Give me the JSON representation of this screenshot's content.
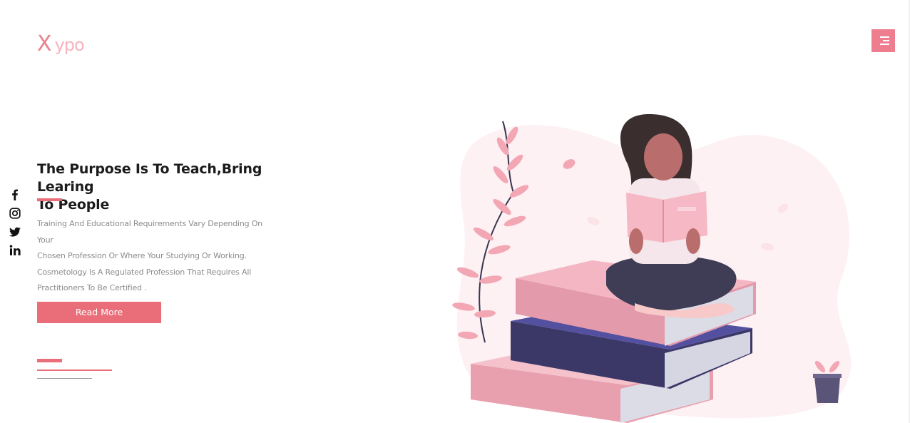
{
  "brand": {
    "logo_first": "X",
    "logo_rest": "ypo",
    "accent": "#e96e79",
    "accent_light": "#f6b3be"
  },
  "nav": {
    "menu_icon": "hamburger-icon"
  },
  "social": [
    {
      "name": "facebook-icon"
    },
    {
      "name": "instagram-icon"
    },
    {
      "name": "twitter-icon"
    },
    {
      "name": "linkedin-icon"
    }
  ],
  "hero": {
    "title_line1": "The Purpose Is To Teach,Bring Learing",
    "title_line2": "To People",
    "desc_line1": "Training And Educational Requirements Vary Depending On Your",
    "desc_line2": "Chosen Profession Or Where Your Studying Or Working.",
    "desc_line3": "Cosmetology Is A Regulated Profession That Requires All",
    "desc_line4": "Practitioners To Be Certified .",
    "button_label": "Read More"
  },
  "illustration": {
    "name": "girl-reading-on-books-illustration"
  }
}
